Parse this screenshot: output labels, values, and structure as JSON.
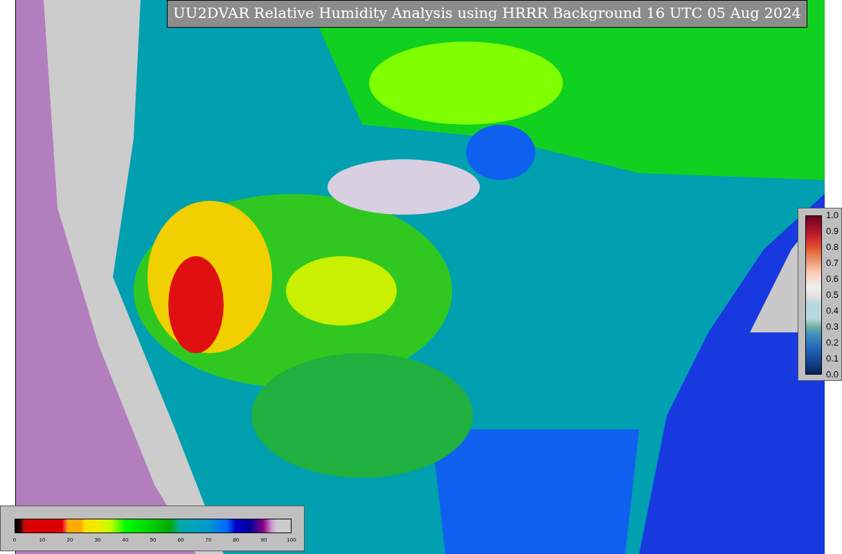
{
  "title": "UU2DVAR Relative Humidity Analysis using HRRR Background 16 UTC 05 Aug 2024",
  "humidity_colorbar": {
    "ticks": [
      "0",
      "10",
      "20",
      "30",
      "40",
      "50",
      "60",
      "70",
      "80",
      "90",
      "100"
    ]
  },
  "ratio_colorbar": {
    "ticks": [
      "1.0",
      "0.9",
      "0.8",
      "0.7",
      "0.6",
      "0.5",
      "0.4",
      "0.3",
      "0.2",
      "0.1",
      "0.0"
    ]
  }
}
